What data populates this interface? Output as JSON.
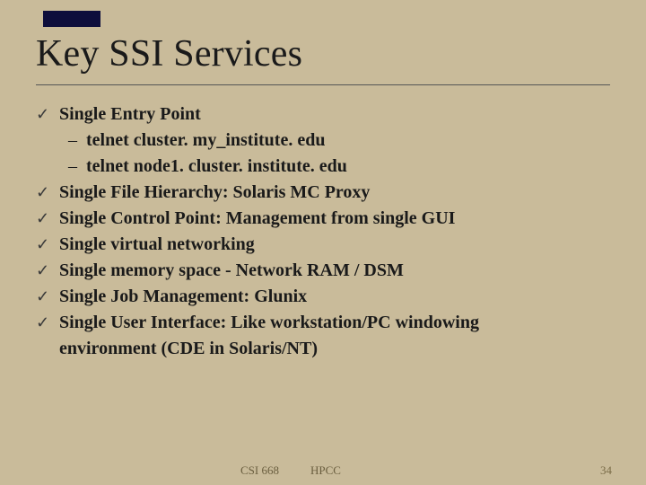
{
  "slide": {
    "title": "Key SSI Services",
    "bullets_top": [
      {
        "text": "Single Entry Point"
      }
    ],
    "sub_bullets": [
      {
        "text": "telnet cluster. my_institute. edu"
      },
      {
        "text": "telnet node1. cluster. institute. edu"
      }
    ],
    "bullets_rest": [
      {
        "text": "Single File Hierarchy:   Solaris MC Proxy"
      },
      {
        "text": "Single Control Point: Management from single GUI"
      },
      {
        "text": "Single virtual networking"
      },
      {
        "text": "Single memory space - Network RAM / DSM"
      },
      {
        "text": "Single Job Management:   Glunix"
      },
      {
        "text": "Single User Interface: Like workstation/PC windowing"
      }
    ],
    "wrap_line": "environment (CDE in Solaris/NT)",
    "tick_glyph": "✓",
    "dash_glyph": "–"
  },
  "footer": {
    "code": "CSI 668",
    "topic": "HPCC",
    "page": "34"
  }
}
